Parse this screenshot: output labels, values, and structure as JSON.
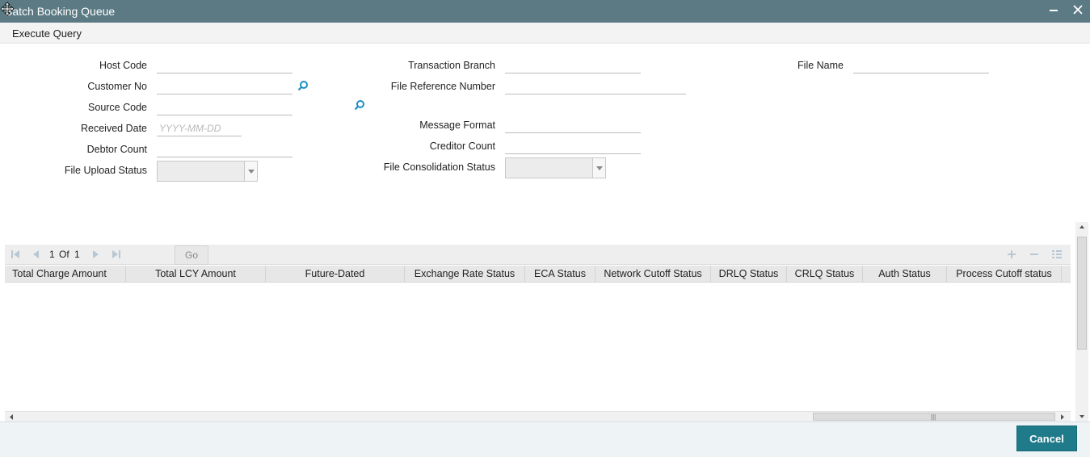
{
  "window": {
    "title": "Batch Booking Queue",
    "minimize_glyph": "▬",
    "close_glyph": "✕"
  },
  "menu": {
    "execute_query": "Execute Query"
  },
  "form": {
    "host_code": {
      "label": "Host Code",
      "value": ""
    },
    "customer_no": {
      "label": "Customer No",
      "value": ""
    },
    "source_code": {
      "label": "Source Code",
      "value": ""
    },
    "received_date": {
      "label": "Received Date",
      "value": "",
      "placeholder": "YYYY-MM-DD"
    },
    "debtor_count": {
      "label": "Debtor Count",
      "value": ""
    },
    "file_upload_status": {
      "label": "File Upload Status",
      "value": ""
    },
    "transaction_branch": {
      "label": "Transaction Branch",
      "value": ""
    },
    "file_reference_number": {
      "label": "File Reference Number",
      "value": ""
    },
    "message_format": {
      "label": "Message Format",
      "value": ""
    },
    "creditor_count": {
      "label": "Creditor Count",
      "value": ""
    },
    "file_consolidation_status": {
      "label": "File Consolidation Status",
      "value": ""
    },
    "file_name": {
      "label": "File Name",
      "value": ""
    }
  },
  "grid": {
    "pagination": {
      "current": "1",
      "of_label": "Of",
      "total": "1",
      "go_label": "Go"
    },
    "columns": [
      "Total Charge Amount",
      "Total LCY Amount",
      "Future-Dated",
      "Exchange Rate Status",
      "ECA Status",
      "Network Cutoff Status",
      "DRLQ Status",
      "CRLQ Status",
      "Auth Status",
      "Process Cutoff status"
    ],
    "rows": [],
    "scroll_thumb_glyph": "|||"
  },
  "footer": {
    "cancel_label": "Cancel"
  },
  "colors": {
    "titlebar": "#5c7a84",
    "accent": "#1f7a8a",
    "search_icon": "#1a8fc4"
  },
  "icons": [
    "move-cursor-icon",
    "minimize-icon",
    "close-icon",
    "search-icon",
    "chevron-down-icon",
    "first-page-icon",
    "prev-page-icon",
    "next-page-icon",
    "last-page-icon",
    "add-row-icon",
    "delete-row-icon",
    "columns-icon"
  ]
}
